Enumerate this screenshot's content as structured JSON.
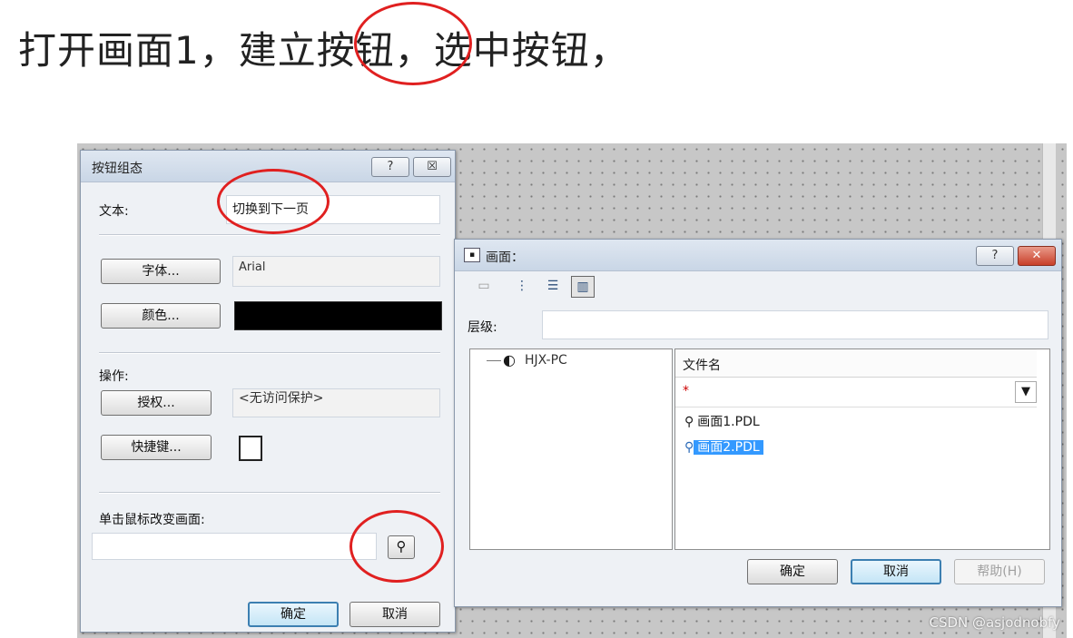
{
  "heading": "打开画面1，建立按钮，选中按钮，",
  "button_dialog": {
    "title": "按钮组态",
    "help_btn": "?",
    "close_btn": "☒",
    "text_label": "文本:",
    "text_value": "切换到下一页",
    "font_button": "字体...",
    "font_value": "Arial",
    "color_button": "颜色...",
    "color_value": "#000000",
    "operation_label": "操作:",
    "auth_button": "授权...",
    "auth_value": "<无访问保护>",
    "hotkey_button": "快捷键...",
    "click_change_label": "单击鼠标改变画面:",
    "click_change_value": "",
    "ok_button": "确定",
    "cancel_button": "取消"
  },
  "picture_dialog": {
    "title": "画面：",
    "help_btn": "?",
    "close_btn": "✕",
    "level_label": "层级:",
    "level_value": "",
    "tree_root": "HJX-PC",
    "column_header": "文件名",
    "filter_value": "*",
    "files": [
      "画面1.PDL",
      "画面2.PDL"
    ],
    "selected_file": "画面2.PDL",
    "ok_button": "确定",
    "cancel_button": "取消",
    "help_button": "帮助(H)"
  },
  "watermark": "CSDN @asjodnobfy"
}
